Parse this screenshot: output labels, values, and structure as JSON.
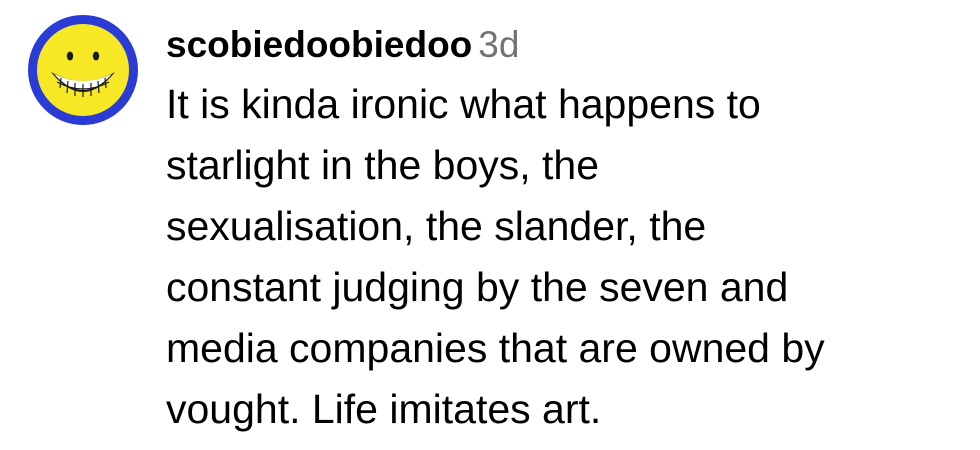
{
  "comment": {
    "avatar": {
      "icon": "smiley-face-icon",
      "ring_color": "#2a3bd6",
      "face_color": "#f7e826"
    },
    "username": "scobiedoobiedoo",
    "timestamp": "3d",
    "text_lines": [
      "It is kinda ironic what happens to",
      "starlight in the boys, the",
      "sexualisation, the slander, the",
      "constant judging by the seven and",
      "media companies that are owned by",
      "vought. Life imitates art."
    ]
  }
}
